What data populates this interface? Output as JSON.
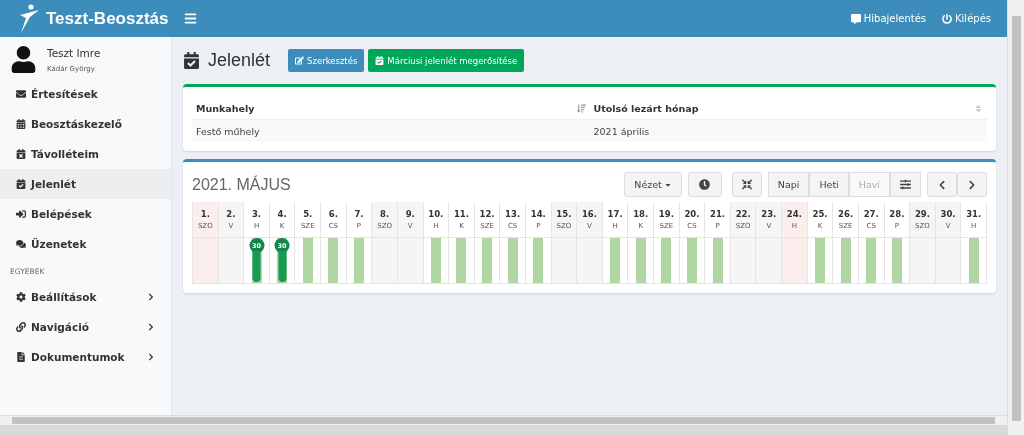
{
  "topbar": {
    "brand": "Teszt-Beosztás",
    "links": [
      {
        "kind": "report",
        "label": "Hibajelentés"
      },
      {
        "kind": "logout",
        "label": "Kilépés"
      }
    ]
  },
  "user": {
    "name": "Teszt Imre",
    "subtitle": "Kádár György"
  },
  "sidebar": {
    "items": [
      {
        "label": "Értesítések",
        "selected": false
      },
      {
        "label": "Beosztáskezelő",
        "selected": false
      },
      {
        "label": "Távolléteim",
        "selected": false
      },
      {
        "label": "Jelenlét",
        "selected": true
      },
      {
        "label": "Belépések",
        "selected": false
      },
      {
        "label": "Üzenetek",
        "selected": false
      }
    ],
    "section": "EGYEBEK",
    "more": [
      {
        "label": "Beállítások",
        "selected": false,
        "submenu": true
      },
      {
        "label": "Navigáció",
        "selected": false,
        "submenu": true
      },
      {
        "label": "Dokumentumok",
        "selected": false,
        "submenu": true
      }
    ]
  },
  "page": {
    "title": "Jelenlét",
    "buttons": [
      {
        "kind": "edit",
        "label": "Szerkesztés"
      },
      {
        "kind": "confirm",
        "label": "Márciusi jelenlét megerősítése"
      }
    ]
  },
  "table": {
    "columns": [
      "Munkahely",
      "Utolsó lezárt hónap"
    ],
    "rows": [
      [
        "Festő műhely",
        "2021 április"
      ]
    ]
  },
  "calendar": {
    "title": "2021. MÁJUS",
    "view_menu": "Nézet",
    "views": [
      {
        "label": "Napi",
        "selected": false
      },
      {
        "label": "Heti",
        "selected": false
      },
      {
        "label": "Havi",
        "selected": true
      }
    ],
    "days": [
      {
        "num": "1.",
        "dow": "SZO",
        "kind": "holiday"
      },
      {
        "num": "2.",
        "dow": "V",
        "kind": "weekend"
      },
      {
        "num": "3.",
        "dow": "H",
        "kind": "work",
        "badge": "30"
      },
      {
        "num": "4.",
        "dow": "K",
        "kind": "work",
        "badge": "30"
      },
      {
        "num": "5.",
        "dow": "SZE",
        "kind": "work"
      },
      {
        "num": "6.",
        "dow": "CS",
        "kind": "work"
      },
      {
        "num": "7.",
        "dow": "P",
        "kind": "work"
      },
      {
        "num": "8.",
        "dow": "SZO",
        "kind": "weekend"
      },
      {
        "num": "9.",
        "dow": "V",
        "kind": "weekend"
      },
      {
        "num": "10.",
        "dow": "H",
        "kind": "work"
      },
      {
        "num": "11.",
        "dow": "K",
        "kind": "work"
      },
      {
        "num": "12.",
        "dow": "SZE",
        "kind": "work"
      },
      {
        "num": "13.",
        "dow": "CS",
        "kind": "work"
      },
      {
        "num": "14.",
        "dow": "P",
        "kind": "work"
      },
      {
        "num": "15.",
        "dow": "SZO",
        "kind": "weekend"
      },
      {
        "num": "16.",
        "dow": "V",
        "kind": "weekend"
      },
      {
        "num": "17.",
        "dow": "H",
        "kind": "work"
      },
      {
        "num": "18.",
        "dow": "K",
        "kind": "work"
      },
      {
        "num": "19.",
        "dow": "SZE",
        "kind": "work"
      },
      {
        "num": "20.",
        "dow": "CS",
        "kind": "work"
      },
      {
        "num": "21.",
        "dow": "P",
        "kind": "work"
      },
      {
        "num": "22.",
        "dow": "SZO",
        "kind": "weekend"
      },
      {
        "num": "23.",
        "dow": "V",
        "kind": "weekend"
      },
      {
        "num": "24.",
        "dow": "H",
        "kind": "holiday"
      },
      {
        "num": "25.",
        "dow": "K",
        "kind": "work"
      },
      {
        "num": "26.",
        "dow": "SZE",
        "kind": "work"
      },
      {
        "num": "27.",
        "dow": "CS",
        "kind": "work"
      },
      {
        "num": "28.",
        "dow": "P",
        "kind": "work"
      },
      {
        "num": "29.",
        "dow": "SZO",
        "kind": "weekend"
      },
      {
        "num": "30.",
        "dow": "V",
        "kind": "weekend"
      },
      {
        "num": "31.",
        "dow": "H",
        "kind": "work"
      }
    ]
  }
}
